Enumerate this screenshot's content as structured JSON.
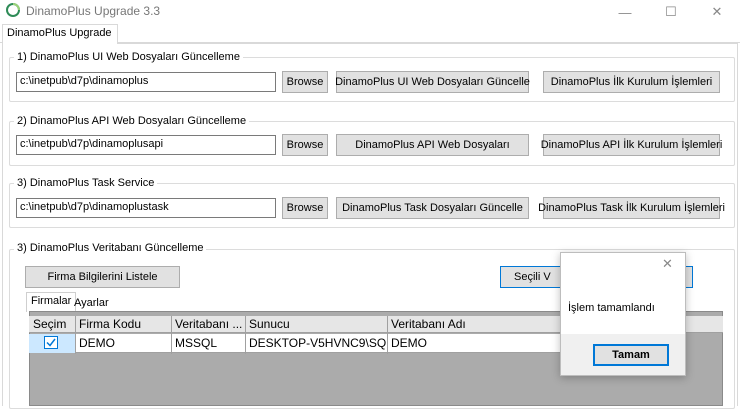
{
  "window": {
    "title": "DinamoPlus Upgrade 3.3",
    "minimize": "—",
    "maximize": "☐",
    "close": "✕"
  },
  "main_tab": {
    "label": "DinamoPlus Upgrade"
  },
  "section_ui": {
    "title": "1) DinamoPlus UI Web Dosyaları Güncelleme",
    "path": "c:\\inetpub\\d7p\\dinamoplus",
    "browse": "Browse",
    "update": "DinamoPlus UI Web Dosyaları Güncelle",
    "setup": "DinamoPlus İlk Kurulum İşlemleri"
  },
  "section_api": {
    "title": "2) DinamoPlus API Web Dosyaları Güncelleme",
    "path": "c:\\inetpub\\d7p\\dinamoplusapi",
    "browse": "Browse",
    "update": "DinamoPlus API Web Dosyaları",
    "setup": "DinamoPlus API İlk Kurulum İşlemleri"
  },
  "section_task": {
    "title": "3) DinamoPlus Task Service",
    "path": "c:\\inetpub\\d7p\\dinamoplustask",
    "browse": "Browse",
    "update": "DinamoPlus Task Dosyaları Güncelle",
    "setup": "DinamoPlus Task İlk Kurulum İşlemleri"
  },
  "section_db": {
    "title": "3) DinamoPlus Veritabanı Güncelleme",
    "list_button": "Firma Bilgilerini Listele",
    "selected_button": "Seçili V",
    "tabs": [
      "Firmalar",
      "Ayarlar"
    ],
    "columns": [
      "Seçim",
      "Firma Kodu",
      "Veritabanı ...",
      "Sunucu",
      "Veritabanı Adı"
    ],
    "rows": [
      {
        "checked": true,
        "firma_kodu": "DEMO",
        "veritabani": "MSSQL",
        "sunucu": "DESKTOP-V5HVNC9\\SQ...",
        "veritabani_adi": "DEMO"
      }
    ]
  },
  "dialog": {
    "message": "İşlem tamamlandı",
    "ok": "Tamam",
    "close": "✕"
  },
  "colors": {
    "accent": "#0078d7",
    "button_bg": "#e1e1e1",
    "grid_bg": "#ababab",
    "row_selected": "#cce8ff"
  }
}
